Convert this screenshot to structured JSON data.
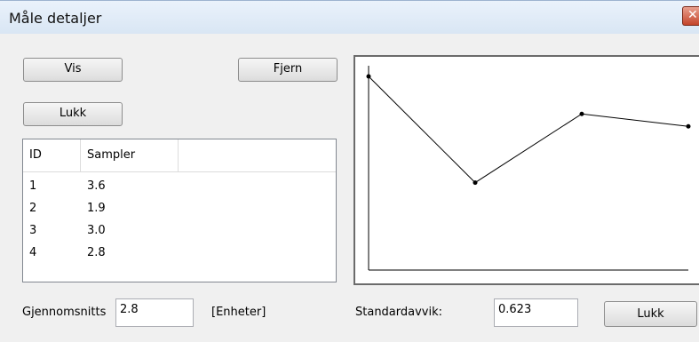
{
  "window": {
    "title": "Måle detaljer"
  },
  "buttons": {
    "show": "Vis",
    "remove": "Fjern",
    "close_top": "Lukk",
    "close_bottom": "Lukk"
  },
  "list": {
    "columns": [
      "ID",
      "Sampler"
    ],
    "rows": [
      {
        "id": "1",
        "sample": "3.6"
      },
      {
        "id": "2",
        "sample": "1.9"
      },
      {
        "id": "3",
        "sample": "3.0"
      },
      {
        "id": "4",
        "sample": "2.8"
      }
    ]
  },
  "footer": {
    "average_label": "Gjennomsnitts",
    "average_value": "2.8",
    "unit_label": "[Enheter]",
    "stddev_label": "Standardavvik:",
    "stddev_value": "0.623"
  },
  "chart_data": {
    "type": "line",
    "x": [
      1,
      2,
      3,
      4
    ],
    "y": [
      3.6,
      1.9,
      3.0,
      2.8
    ],
    "title": "",
    "xlabel": "",
    "ylabel": "",
    "grid": false
  },
  "colors": {
    "line": "#000000",
    "close_button": "#c4442b"
  }
}
